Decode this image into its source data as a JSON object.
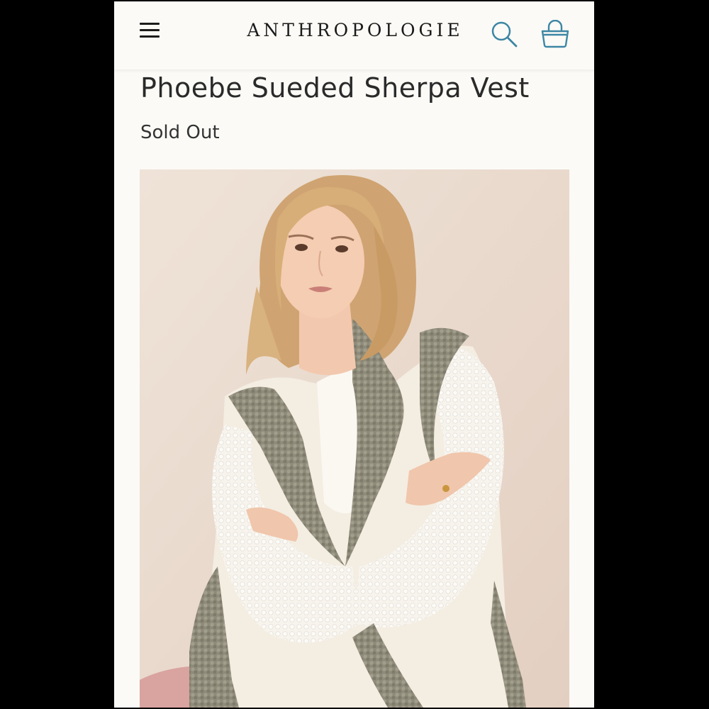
{
  "header": {
    "brand": "ANTHROPOLOGIE",
    "menu_icon": "hamburger-menu-icon",
    "search_icon": "search-icon",
    "bag_icon": "shopping-bag-icon",
    "accent_color": "#3d86a4"
  },
  "product": {
    "title": "Phoebe Sueded Sherpa Vest",
    "availability": "Sold Out"
  },
  "colors": {
    "page_background": "#fbfaf6",
    "frame_background": "#000000",
    "text": "#2a2a2a",
    "photo_backdrop": "#ead9cc"
  }
}
